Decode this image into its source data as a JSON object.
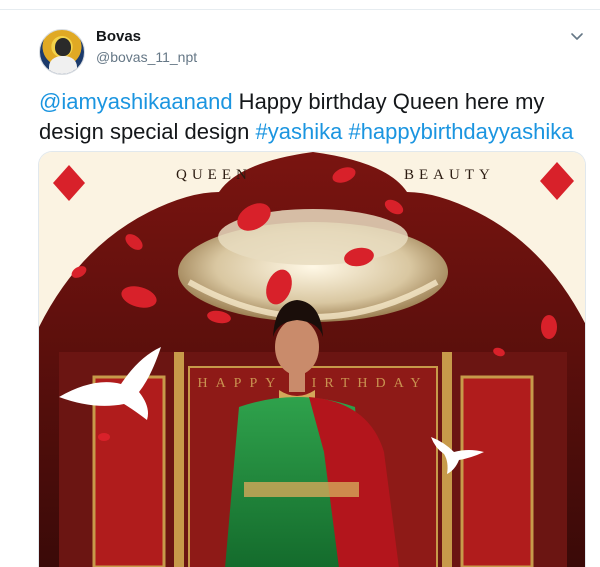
{
  "tweet": {
    "author": {
      "name": "Bovas",
      "handle": "@bovas_11_npt"
    },
    "text": {
      "mention": "@iamyashikaanand",
      "body_1": " Happy birthday Queen here my",
      "body_2": "design special design ",
      "hashtag_1": "#yashika",
      "space": " ",
      "hashtag_2": "#happybirthdayyashika"
    },
    "media": {
      "poster_left_word": "QUEEN",
      "poster_right_word": "BEAUTY",
      "poster_banner": "HAPPY BIRTHDAY"
    }
  },
  "colors": {
    "link": "#1b95e0",
    "handle": "#657786",
    "poster_red": "#d8212a",
    "poster_cream": "#fbf3e2",
    "saree_green": "#1f8a3b"
  },
  "icons": {
    "menu": "chevron-down-icon",
    "diamonds": "diamond-suit-icon",
    "birds": "dove-icon"
  }
}
